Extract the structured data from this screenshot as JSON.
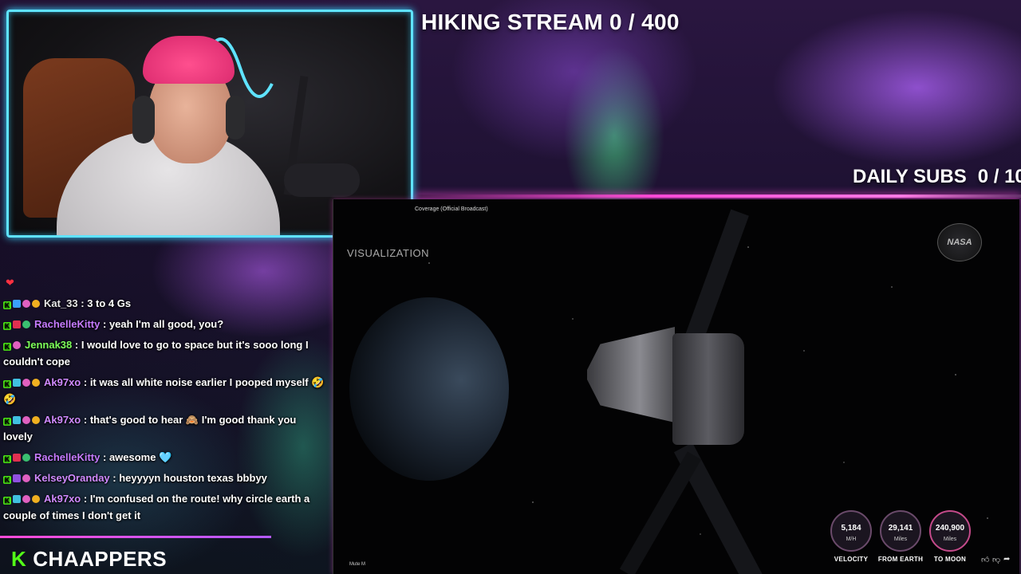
{
  "stream_title": "HIKING STREAM 0 / 400",
  "daily_subs": {
    "label": "DAILY SUBS",
    "count": "0 / 10"
  },
  "video": {
    "title_fragment": "Coverage (Official Broadcast)",
    "overlay_label": "VISUALIZATION",
    "logo": "NASA",
    "timestamp": "Mute M",
    "gauges": [
      {
        "value": "5,184",
        "unit": "M/H",
        "caption": "VELOCITY"
      },
      {
        "value": "29,141",
        "unit": "Miles",
        "caption": "FROM EARTH"
      },
      {
        "value": "240,900",
        "unit": "Miles",
        "caption": "TO MOON"
      }
    ],
    "controls": [
      "thumb-up-icon",
      "thumb-down-icon",
      "share-icon"
    ]
  },
  "chat": {
    "messages": [
      {
        "user": "Kat_33",
        "text": ": 3 to 4 Gs",
        "color": "#e6e6e6"
      },
      {
        "user": "RachelleKitty",
        "text": ": yeah I'm all good, you?",
        "color": "#c67bff"
      },
      {
        "user": "Jennak38",
        "text": ": I would love to go to space but it's sooo long I couldn't cope",
        "color": "#7dff5a"
      },
      {
        "user": "Ak97xo",
        "text": ": it was all white noise earlier I pooped myself 🤣🤣",
        "color": "#d08aff"
      },
      {
        "user": "Ak97xo",
        "text": ": that's good to hear 🙈 I'm good thank you lovely",
        "color": "#d08aff"
      },
      {
        "user": "RachelleKitty",
        "text": ": awesome 🩵",
        "color": "#c67bff"
      },
      {
        "user": "KelseyOranday",
        "text": ": heyyyyn houston texas bbbyy",
        "color": "#d08aff"
      },
      {
        "user": "Ak97xo",
        "text": ": I'm confused on the route! why circle earth a couple of times I don't get it",
        "color": "#d08aff"
      }
    ]
  },
  "brand": {
    "name": "CHAAPPERS",
    "logo": "K"
  },
  "colors": {
    "webcam_border": "#5fe3ff",
    "accent_pink": "#ff4bd8",
    "kick_green": "#53fc18"
  }
}
